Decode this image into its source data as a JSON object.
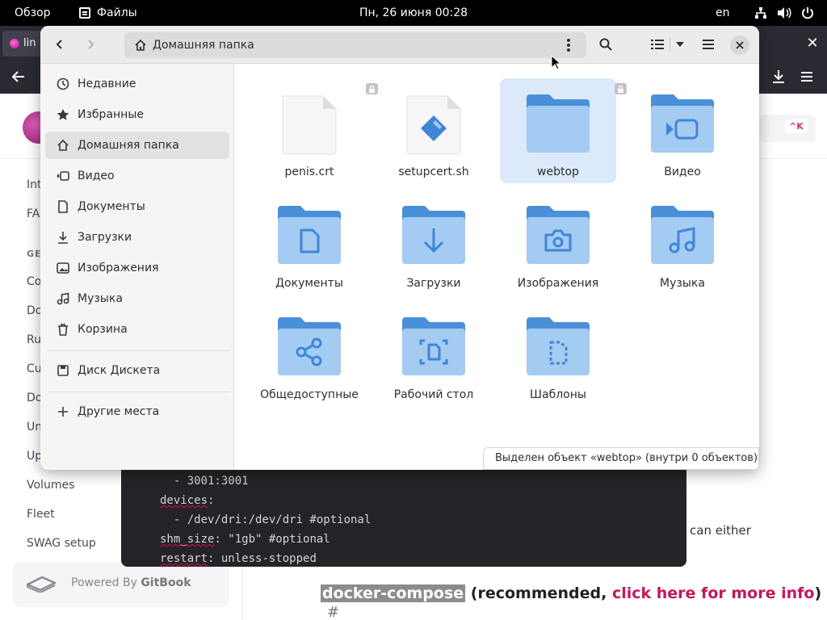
{
  "topbar": {
    "overview": "Обзор",
    "app_name": "Файлы",
    "clock": "Пн, 26 июня  00:28",
    "language": "en",
    "tray_icons": [
      "network-icon",
      "volume-icon",
      "power-icon"
    ]
  },
  "browser": {
    "tab_title": "lin",
    "side_links": [
      "Int",
      "FA",
      "Co",
      "Do",
      "Ru",
      "Cu",
      "Do",
      "Un",
      "Up",
      "Volumes",
      "Fleet",
      "SWAG setup"
    ],
    "section_head": "GE",
    "search_shortcut": "^K",
    "powered_prefix": "Powered By ",
    "powered_brand": "GitBook",
    "code_lines": [
      {
        "text": "  - 3001:3001",
        "key": ""
      },
      {
        "key": "devices",
        "text": ":"
      },
      {
        "text": "  - /dev/dri:/dev/dri #optional",
        "key": ""
      },
      {
        "key": "shm_size",
        "text": ": \"1gb\" #optional"
      },
      {
        "key": "restart",
        "text": ": unless-stopped"
      }
    ],
    "right_text": "can either",
    "compose_highlight": "docker-compose",
    "compose_mid": " (recommended, ",
    "compose_link": "click here for more info",
    "compose_end": ")",
    "anchor": "#"
  },
  "file_manager": {
    "path_label": "Домашняя папка",
    "sidebar": [
      {
        "label": "Недавние",
        "icon": "clock-icon"
      },
      {
        "label": "Избранные",
        "icon": "star-icon"
      },
      {
        "label": "Домашняя папка",
        "icon": "home-icon",
        "active": true
      },
      {
        "label": "Видео",
        "icon": "video-icon"
      },
      {
        "label": "Документы",
        "icon": "document-icon"
      },
      {
        "label": "Загрузки",
        "icon": "download-icon"
      },
      {
        "label": "Изображения",
        "icon": "image-icon"
      },
      {
        "label": "Музыка",
        "icon": "music-icon"
      },
      {
        "label": "Корзина",
        "icon": "trash-icon"
      }
    ],
    "devices": [
      {
        "label": "Диск Дискета",
        "icon": "drive-icon"
      }
    ],
    "other": [
      {
        "label": "Другие места",
        "icon": "plus-icon"
      }
    ],
    "items": [
      {
        "name": "penis.crt",
        "kind": "file",
        "locked": true
      },
      {
        "name": "setupcert.sh",
        "kind": "script",
        "locked": false
      },
      {
        "name": "webtop",
        "kind": "folder",
        "locked": true,
        "selected": true
      },
      {
        "name": "Видео",
        "kind": "folder-video"
      },
      {
        "name": "Документы",
        "kind": "folder-docs"
      },
      {
        "name": "Загрузки",
        "kind": "folder-download"
      },
      {
        "name": "Изображения",
        "kind": "folder-pictures"
      },
      {
        "name": "Музыка",
        "kind": "folder-music"
      },
      {
        "name": "Общедоступные",
        "kind": "folder-public"
      },
      {
        "name": "Рабочий стол",
        "kind": "folder-desktop"
      },
      {
        "name": "Шаблоны",
        "kind": "folder-templates"
      }
    ],
    "status": "Выделен объект «webtop»  (внутри 0 объектов)",
    "colors": {
      "folder_light": "#a4cbf2",
      "folder_tab": "#4a90d9",
      "folder_glyph": "#3f86d6",
      "selection": "#dbe9fa"
    }
  }
}
